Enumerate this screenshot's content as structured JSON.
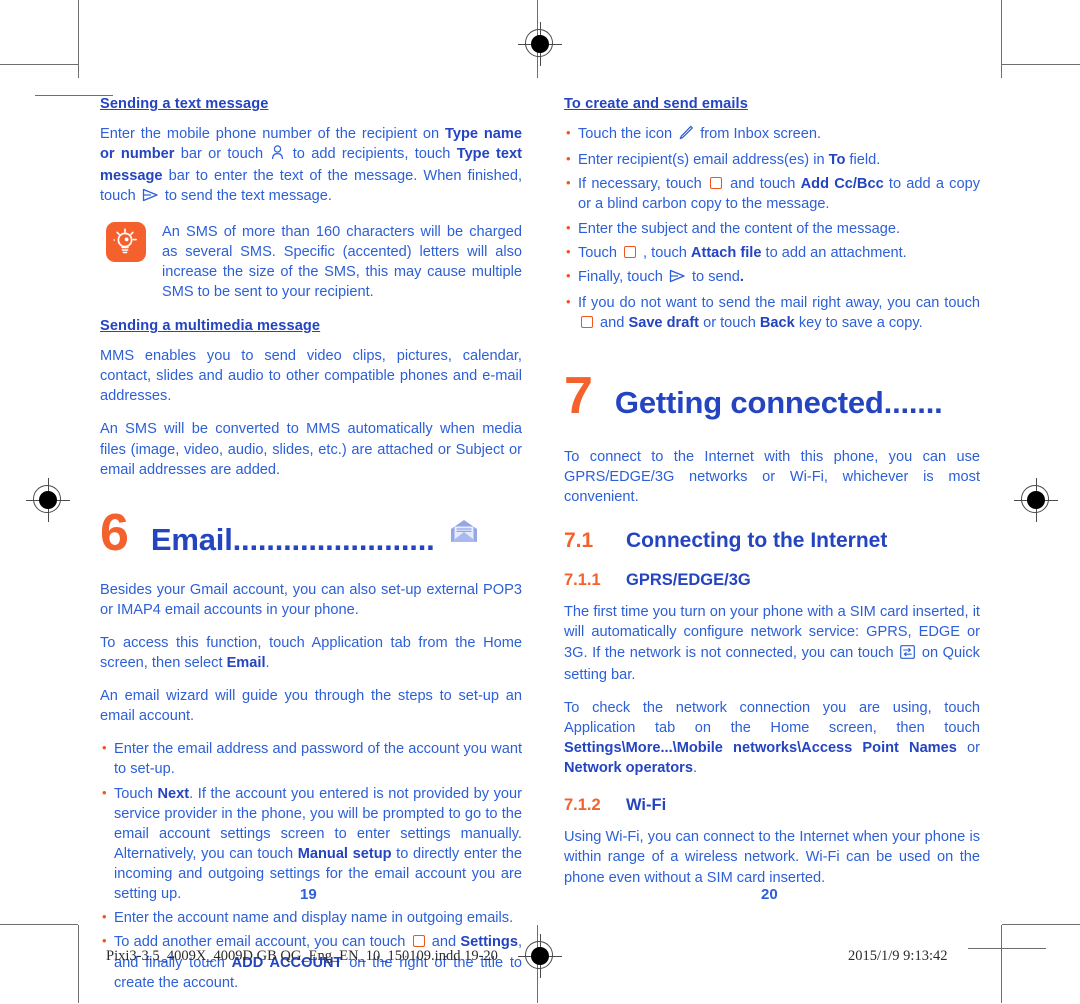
{
  "document": {
    "left_page_number": "19",
    "right_page_number": "20",
    "footer_filename": "Pixi3-3.5_4009X_4009D GB QG_Eng_EN_10_150109.indd   19-20",
    "footer_timestamp": "2015/1/9   9:13:42"
  },
  "colors": {
    "heading_blue": "#2444c0",
    "body_blue": "#2c5fd8",
    "accent_orange": "#f4612c",
    "icon_envelope": "#93a6e8"
  },
  "left_column": {
    "subhead_text_message": "Sending a text message",
    "para_send_text": {
      "a": "Enter the mobile phone number of the recipient on ",
      "b1": "Type name or number",
      "c": " bar or touch ",
      "icon1": "contact-person-icon",
      "d": " to add recipients, touch ",
      "b2": "Type text message",
      "e": " bar to enter the text of the message. When finished, touch ",
      "icon2": "send-arrow-icon",
      "f": " to send the text message."
    },
    "tip": "An SMS of more than 160 characters will be charged as several SMS. Specific (accented) letters will also increase the size of the SMS, this may cause multiple SMS to be sent to your recipient.",
    "tip_icon": "lightbulb-tip-icon",
    "subhead_multimedia": "Sending a multimedia message",
    "para_mms_1": "MMS enables you to send video clips, pictures, calendar, contact, slides and audio to other compatible phones and e-mail addresses.",
    "para_mms_2": "An SMS will be converted to MMS automatically when media files (image, video, audio, slides, etc.) are attached or Subject or email addresses are added.",
    "chapter": {
      "number": "6",
      "title": "Email",
      "leader": "........................",
      "icon": "envelope-icon"
    },
    "para_email_1": "Besides your Gmail account, you can also set-up external POP3 or IMAP4 email accounts in your phone.",
    "para_email_2": {
      "a": "To access this function, touch Application tab from the Home screen, then select ",
      "b": "Email",
      "c": "."
    },
    "para_email_3": "An email wizard will guide you through the steps to set-up an email account.",
    "bullets": [
      {
        "a": "Enter the email address and password of the account you want to set-up."
      },
      {
        "a": "Touch ",
        "b1": "Next",
        "c": ". If the account you entered is not provided by your service provider in the phone, you will be prompted to go to the email account settings screen to enter settings manually. Alternatively, you can touch ",
        "b2": "Manual setup",
        "d": " to directly enter the incoming and outgoing settings for the email account you are setting up."
      },
      {
        "a": "Enter the account name and display name in outgoing emails."
      },
      {
        "a": "To add another email account, you can touch ",
        "icon": "menu-square-icon",
        "c": " and ",
        "b1": "Settings",
        "d": ", and finally touch ",
        "b2": "ADD ACCOUNT",
        "e": " on the right of the title to create the account."
      }
    ]
  },
  "right_column": {
    "subhead_create_emails": "To create and send emails",
    "bullets": [
      {
        "a": "Touch the icon ",
        "icon": "compose-pencil-icon",
        "c": " from Inbox screen."
      },
      {
        "a": "Enter recipient(s) email address(es) in ",
        "b1": "To",
        "c": " field."
      },
      {
        "a": "If necessary, touch ",
        "icon": "menu-square-icon",
        "c": " and touch ",
        "b1": "Add Cc/Bcc",
        "d": " to add a copy or a blind carbon copy to the message."
      },
      {
        "a": "Enter the subject and the content of the message."
      },
      {
        "a": "Touch ",
        "icon": "menu-square-icon",
        "c": " , touch ",
        "b1": "Attach file",
        "d": " to add an attachment."
      },
      {
        "a": "Finally, touch ",
        "icon": "send-arrow-icon",
        "c": " to send",
        "d": "."
      },
      {
        "a": "If you do not want to send the mail right away, you can touch ",
        "icon": "menu-square-icon",
        "c": " and ",
        "b1": "Save draft",
        "d": " or touch ",
        "b2": "Back",
        "e": " key to save a copy."
      }
    ],
    "chapter": {
      "number": "7",
      "title": "Getting connected",
      "leader": "......."
    },
    "para_intro": "To connect to the Internet with this phone, you can use GPRS/EDGE/3G networks or Wi-Fi, whichever is most convenient.",
    "section_7_1": {
      "number": "7.1",
      "title": "Connecting to the Internet"
    },
    "section_7_1_1": {
      "number": "7.1.1",
      "title": "GPRS/EDGE/3G"
    },
    "para_gprs_1": {
      "a": "The first time you turn on your phone with a SIM card inserted, it will automatically configure network service: GPRS, EDGE or 3G. If the network is not connected, you can touch ",
      "icon": "data-transfer-icon",
      "c": " on Quick setting bar."
    },
    "para_gprs_2": {
      "a": "To check the network connection you are using, touch Application tab on the Home screen, then touch ",
      "b1": "Settings\\More...\\Mobile networks\\Access Point Names",
      "c": " or ",
      "b2": "Network operators",
      "d": "."
    },
    "section_7_1_2": {
      "number": "7.1.2",
      "title": "Wi-Fi"
    },
    "para_wifi": "Using Wi-Fi, you can connect to the Internet when your phone is within range of a wireless network. Wi-Fi can be used on the phone even without a SIM card inserted."
  }
}
